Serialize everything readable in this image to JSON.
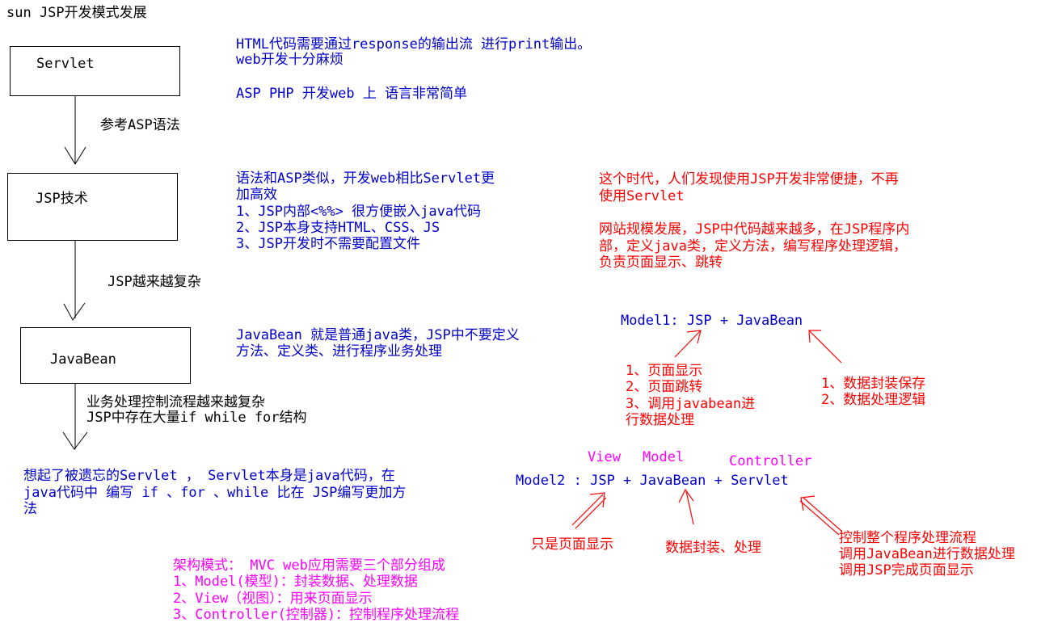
{
  "title": "sun JSP开发模式发展",
  "boxes": {
    "servlet": "Servlet",
    "jsp": "JSP技术",
    "javabean": "JavaBean"
  },
  "transitions": {
    "t1": "参考ASP语法",
    "t2": "JSP越来越复杂",
    "t3_line1": "业务处理控制流程越来越复杂",
    "t3_line2": "JSP中存在大量if while for结构"
  },
  "servlet_notes": {
    "line1": "HTML代码需要通过response的输出流 进行print输出。",
    "line2": "web开发十分麻烦",
    "line3": "ASP PHP 开发web 上 语言非常简单"
  },
  "jsp_notes": {
    "line1": "语法和ASP类似，开发web相比Servlet更",
    "line2": "加高效",
    "line3": "1、JSP内部<%%> 很方便嵌入java代码",
    "line4": "2、JSP本身支持HTML、CSS、JS",
    "line5": "3、JSP开发时不需要配置文件"
  },
  "era_notes": {
    "line1": "这个时代，人们发现使用JSP开发非常便捷，不再",
    "line2": "使用Servlet",
    "line3": "网站规模发展，JSP中代码越来越多，在JSP程序内",
    "line4": "部，定义java类，定义方法，编写程序处理逻辑，",
    "line5": "负责页面显示、跳转"
  },
  "javabean_notes": {
    "line1": "JavaBean 就是普通java类，JSP中不要定义",
    "line2": "方法、定义类、进行程序业务处理"
  },
  "model1": {
    "formula": "Model1: JSP + JavaBean",
    "jsp_roles": [
      "1、页面显示",
      "2、页面跳转",
      "3、调用javabean进",
      "行数据处理"
    ],
    "bean_roles": [
      "1、数据封装保存",
      "2、数据处理逻辑"
    ]
  },
  "model2": {
    "label_view": "View",
    "label_model": "Model",
    "label_controller": "Controller",
    "formula": "Model2 : JSP + JavaBean + Servlet",
    "jsp_role": "只是页面显示",
    "bean_role": "数据封装、处理",
    "servlet_roles": [
      "控制整个程序处理流程",
      "调用JavaBean进行数据处理",
      "调用JSP完成页面显示"
    ]
  },
  "servlet_return": {
    "line1": "想起了被遗忘的Servlet ， Servlet本身是java代码，在",
    "line2": "java代码中 编写 if 、for 、while 比在 JSP编写更加方",
    "line3": "法"
  },
  "mvc": {
    "line1": "架构模式： MVC web应用需要三个部分组成",
    "line2": "1、Model(模型)：封装数据、处理数据",
    "line3": "2、View（视图）：用来页面显示",
    "line4": "3、Controller(控制器)：控制程序处理流程"
  }
}
